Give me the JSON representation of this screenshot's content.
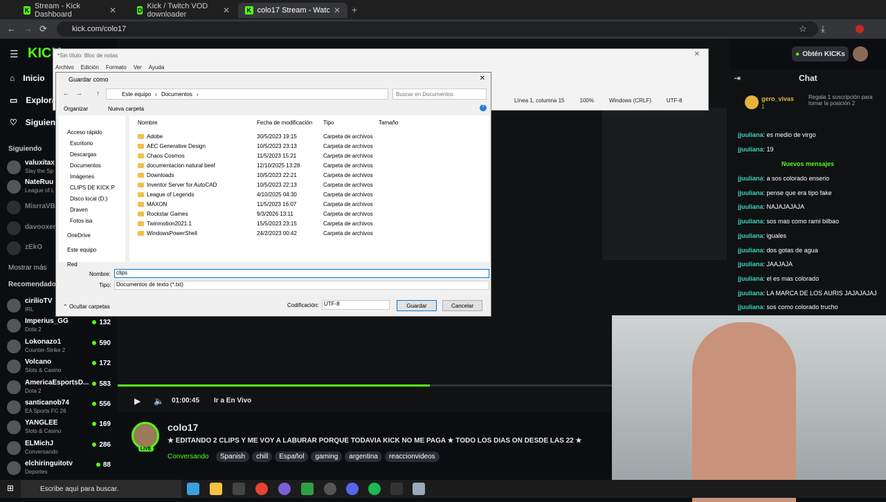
{
  "browser": {
    "tabs": [
      {
        "label": "Stream - Kick Dashboard"
      },
      {
        "label": "Kick / Twitch VOD downloader"
      },
      {
        "label": "colo17 Stream - Watch Live on"
      }
    ],
    "url": "kick.com/colo17"
  },
  "kick": {
    "logo": "KICK",
    "nav": {
      "home": "Inicio",
      "explore": "Explora",
      "following": "Siguiendo"
    },
    "following_title": "Siguiendo",
    "following": [
      {
        "name": "valuxitax",
        "game": "Slay the Sp"
      },
      {
        "name": "NateRuu",
        "game": "League of L"
      },
      {
        "name": "MisrraVB",
        "game": ""
      },
      {
        "name": "davooxen",
        "game": ""
      },
      {
        "name": "zEkO",
        "game": ""
      }
    ],
    "show_more": "Mostrar más",
    "recommended_title": "Recomendado",
    "recommended": [
      {
        "name": "cirilioTV",
        "game": "IRL",
        "viewers": ""
      },
      {
        "name": "Imperius_GG",
        "game": "Dota 2",
        "viewers": "132"
      },
      {
        "name": "Lokonazo1",
        "game": "Counter-Strike 2",
        "viewers": "590"
      },
      {
        "name": "Volcano",
        "game": "Slots & Casino",
        "viewers": "172"
      },
      {
        "name": "AmericaEsportsD...",
        "game": "Dota 2",
        "viewers": "583"
      },
      {
        "name": "santicanob74",
        "game": "EA Sports FC 26",
        "viewers": "556"
      },
      {
        "name": "YANGLEE",
        "game": "Slots & Casino",
        "viewers": "169"
      },
      {
        "name": "ELMichJ",
        "game": "Conversando",
        "viewers": "286"
      },
      {
        "name": "elchiringuitotv",
        "game": "Deportes",
        "viewers": "88"
      }
    ],
    "get_kicks": "Obtén KICKs",
    "player": {
      "time": "01:00:45",
      "live_label": "Ir a En Vivo",
      "progress": 0.51
    },
    "streamer": {
      "name": "colo17",
      "live": "LIVE",
      "title": "★ EDITANDO 2 CLIPS Y ME VOY A LABURAR PORQUE TODAVIA KICK NO ME PAGA ★ TODO LOS DIAS ON DESDE LAS 22 ★",
      "category": "Conversando",
      "tags": [
        "Spanish",
        "chill",
        "Español",
        "gaming",
        "argentina",
        "reaccionvideos"
      ]
    },
    "chat": {
      "title": "Chat",
      "gifter": "gero_vivas",
      "gifter_count": "1",
      "gift_text": "Regala 1 suscripción para tomar la posición 2",
      "new_messages": "Nuevos mensajes",
      "messages_before": [
        {
          "user": "jjuuliana",
          "text": "es medio de virgo"
        },
        {
          "user": "jjuuliana",
          "text": "19"
        }
      ],
      "messages_after": [
        {
          "user": "jjuuliana",
          "text": "a sos colorado enserio"
        },
        {
          "user": "jjuuliana",
          "text": "pense que era tipo fake"
        },
        {
          "user": "jjuuliana",
          "text": "NAJAJAJAJA"
        },
        {
          "user": "jjuuliana",
          "text": "sos mas como rami bilbao"
        },
        {
          "user": "jjuuliana",
          "text": "iguales"
        },
        {
          "user": "jjuuliana",
          "text": "dos gotas de agua"
        },
        {
          "user": "jjuuliana",
          "text": "JAAJAJA"
        },
        {
          "user": "jjuuliana",
          "text": "el es mas colorado"
        },
        {
          "user": "jjuuliana",
          "text": "LA MARCA DE LOS AURIS JAJAJAJAJ"
        },
        {
          "user": "jjuuliana",
          "text": "sos como colorado trucho"
        }
      ]
    }
  },
  "notepad": {
    "title": "*Sin título: Bloc de notas",
    "menu": [
      "Archivo",
      "Edición",
      "Formato",
      "Ver",
      "Ayuda"
    ],
    "status": [
      "Línea 1, columna 15",
      "100%",
      "Windows (CRLF)",
      "UTF-8"
    ]
  },
  "dialog": {
    "title": "Guardar como",
    "breadcrumb": [
      "Este equipo",
      "Documentos"
    ],
    "search_placeholder": "Buscar en Documentos",
    "organize": "Organizar",
    "new_folder": "Nueva carpeta",
    "columns": [
      "Nombre",
      "Fecha de modificación",
      "Tipo",
      "Tamaño"
    ],
    "tree": [
      "Acceso rápido",
      "Escritorio",
      "Descargas",
      "Documentos",
      "Imágenes",
      "CLIPS DE KICK P",
      "Disco local (D:)",
      "Draven",
      "Fotos isa",
      "OneDrive",
      "Este equipo",
      "Red"
    ],
    "files": [
      {
        "name": "Adobe",
        "date": "30/5/2023 19:15",
        "type": "Carpeta de archivos"
      },
      {
        "name": "AEC Generative Design",
        "date": "10/5/2023 23:13",
        "type": "Carpeta de archivos"
      },
      {
        "name": "Chaos Cosmos",
        "date": "11/5/2023 15:21",
        "type": "Carpeta de archivos"
      },
      {
        "name": "documentacion natural beef",
        "date": "12/10/2025 13:28",
        "type": "Carpeta de archivos"
      },
      {
        "name": "Downloads",
        "date": "10/5/2023 22:21",
        "type": "Carpeta de archivos"
      },
      {
        "name": "Inventor Server for AutoCAD",
        "date": "10/5/2023 22:13",
        "type": "Carpeta de archivos"
      },
      {
        "name": "League of Legends",
        "date": "4/10/2025 04:30",
        "type": "Carpeta de archivos"
      },
      {
        "name": "MAXON",
        "date": "11/5/2023 16:07",
        "type": "Carpeta de archivos"
      },
      {
        "name": "Rockstar Games",
        "date": "9/3/2026 13:11",
        "type": "Carpeta de archivos"
      },
      {
        "name": "Twinmotion2021.1",
        "date": "15/5/2023 23:15",
        "type": "Carpeta de archivos"
      },
      {
        "name": "WindowsPowerShell",
        "date": "24/2/2023 00:42",
        "type": "Carpeta de archivos"
      }
    ],
    "filename_label": "Nombre:",
    "filename_value": "clips",
    "type_label": "Tipo:",
    "type_value": "Documentos de texto (*.txt)",
    "hide_folders": "Ocultar carpetas",
    "encoding_label": "Codificación:",
    "encoding_value": "UTF-8",
    "save": "Guardar",
    "cancel": "Cancelar"
  },
  "taskbar": {
    "search_placeholder": "Escribe aquí para buscar."
  }
}
